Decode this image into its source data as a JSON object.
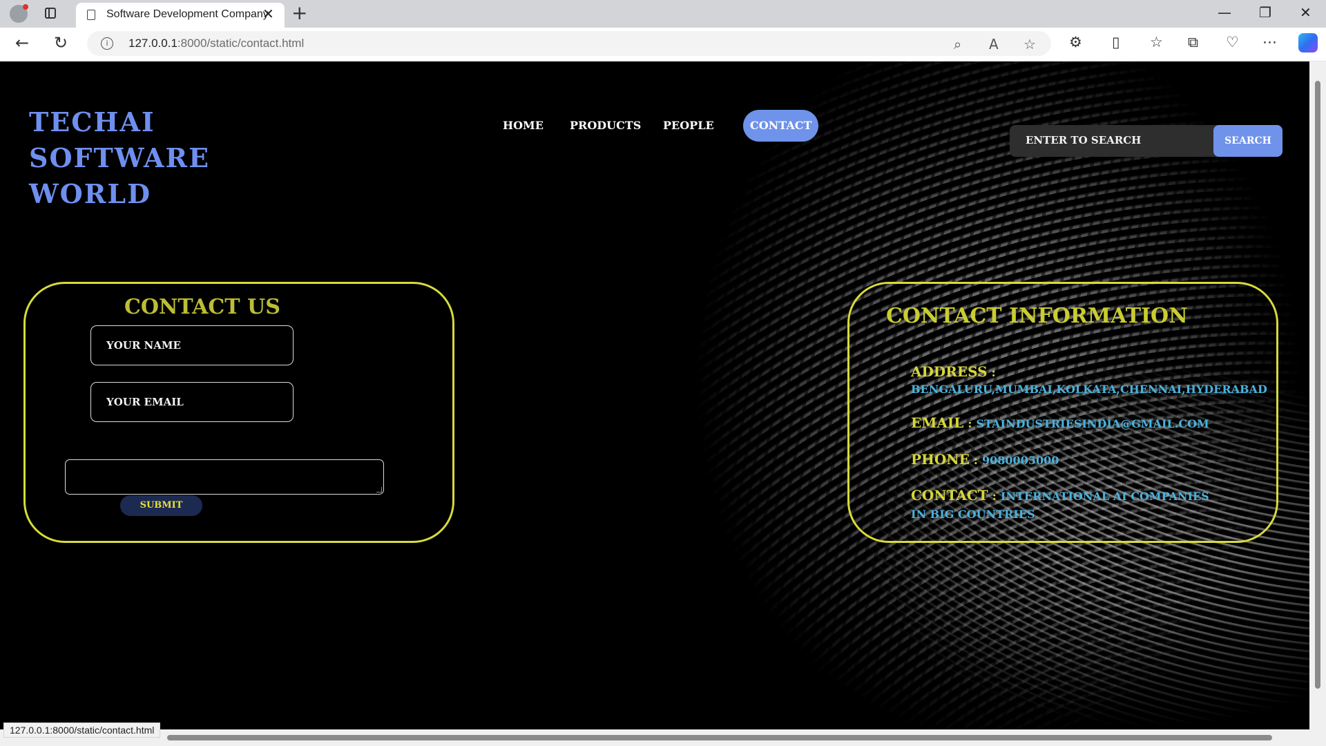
{
  "browser": {
    "tab_title": "Software Development Company",
    "tab_close": "✕",
    "new_tab": "+",
    "url_host": "127.0.0.1",
    "url_path": ":8000/static/contact.html",
    "status_url": "127.0.0.1:8000/static/contact.html",
    "icons": {
      "back": "←",
      "reload": "↻",
      "info": "i",
      "zoom": "⌕",
      "read_aloud": "A",
      "favorite": "☆",
      "extensions": "⚙",
      "split": "▯",
      "favorites": "☆",
      "collections": "⧉",
      "health": "♡",
      "more": "⋯",
      "minimize": "—",
      "maximize": "❐",
      "close": "✕"
    }
  },
  "site": {
    "logo": "TECHAI SOFTWARE WORLD",
    "nav": [
      "HOME",
      "PRODUCTS",
      "PEOPLE",
      "CONTACT"
    ],
    "search_placeholder": "ENTER TO SEARCH",
    "search_button": "SEARCH"
  },
  "contact_form": {
    "title": "CONTACT US",
    "name_placeholder": "YOUR NAME",
    "email_placeholder": "YOUR EMAIL",
    "message_value": "",
    "submit_label": "SUBMIT"
  },
  "contact_info": {
    "title": "CONTACT INFORMATION",
    "address_label": "ADDRESS",
    "address_value": "BENGALURU,MUMBAI,KOLKATA,CHENNAI,HYDERABAD",
    "email_label": "EMAIL",
    "email_value": "STAINDUSTRIESINDIA@GMAIL.COM",
    "phone_label": "PHONE",
    "phone_value": "9080005000",
    "contact_label": "CONTACT",
    "contact_value_1": "INTERNATIONAL AI COMPANIES",
    "contact_value_2": "IN BIG COUNTRIES"
  },
  "colors": {
    "logo": "#6f8ff0",
    "accent_blue": "#6f93ea",
    "panel_border": "#d6dc3a",
    "info_value": "#4ab2dc",
    "submit_bg": "#1c2a52"
  }
}
